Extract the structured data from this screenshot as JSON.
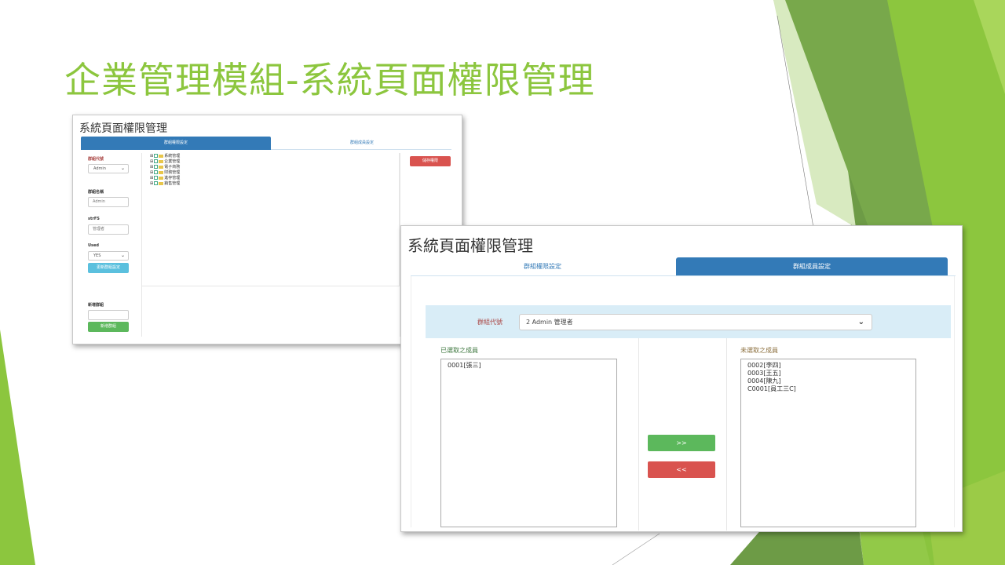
{
  "slide": {
    "title": "企業管理模組-系統頁面權限管理",
    "accent_color": "#8cc63e"
  },
  "shot1": {
    "page_title": "系統頁面權限管理",
    "tabs": [
      {
        "label": "群組權限設定",
        "active": true
      },
      {
        "label": "群組成員設定",
        "active": false
      }
    ],
    "form": {
      "group_code_label": "群組代號",
      "group_code_value": "Admin",
      "group_name_label": "群組名稱",
      "group_name_value": "Admin",
      "strFS_label": "strFS",
      "strFS_value": "管理者",
      "used_label": "Used",
      "used_value": "YES",
      "update_button": "更新群組設定",
      "new_group_label": "新增群組",
      "new_group_value": "",
      "add_button": "新增群組"
    },
    "tree": [
      "系統管理",
      "企業管理",
      "電子商務",
      "財務管理",
      "進存管理",
      "銷售管理"
    ],
    "save_button": "儲存權限"
  },
  "shot2": {
    "page_title": "系統頁面權限管理",
    "tabs": [
      {
        "label": "群組權限設定",
        "active": false
      },
      {
        "label": "群組成員設定",
        "active": true
      }
    ],
    "group_code_label": "群組代號",
    "group_select_value": "2 Admin 管理者",
    "selected_label": "已選取之成員",
    "selected_members": [
      "0001[張三]"
    ],
    "unselected_label": "未選取之成員",
    "unselected_members": [
      "0002[李四]",
      "0003[王五]",
      "0004[陳九]",
      "C0001[員工三C]"
    ],
    "add_button": ">>",
    "remove_button": "<<"
  }
}
